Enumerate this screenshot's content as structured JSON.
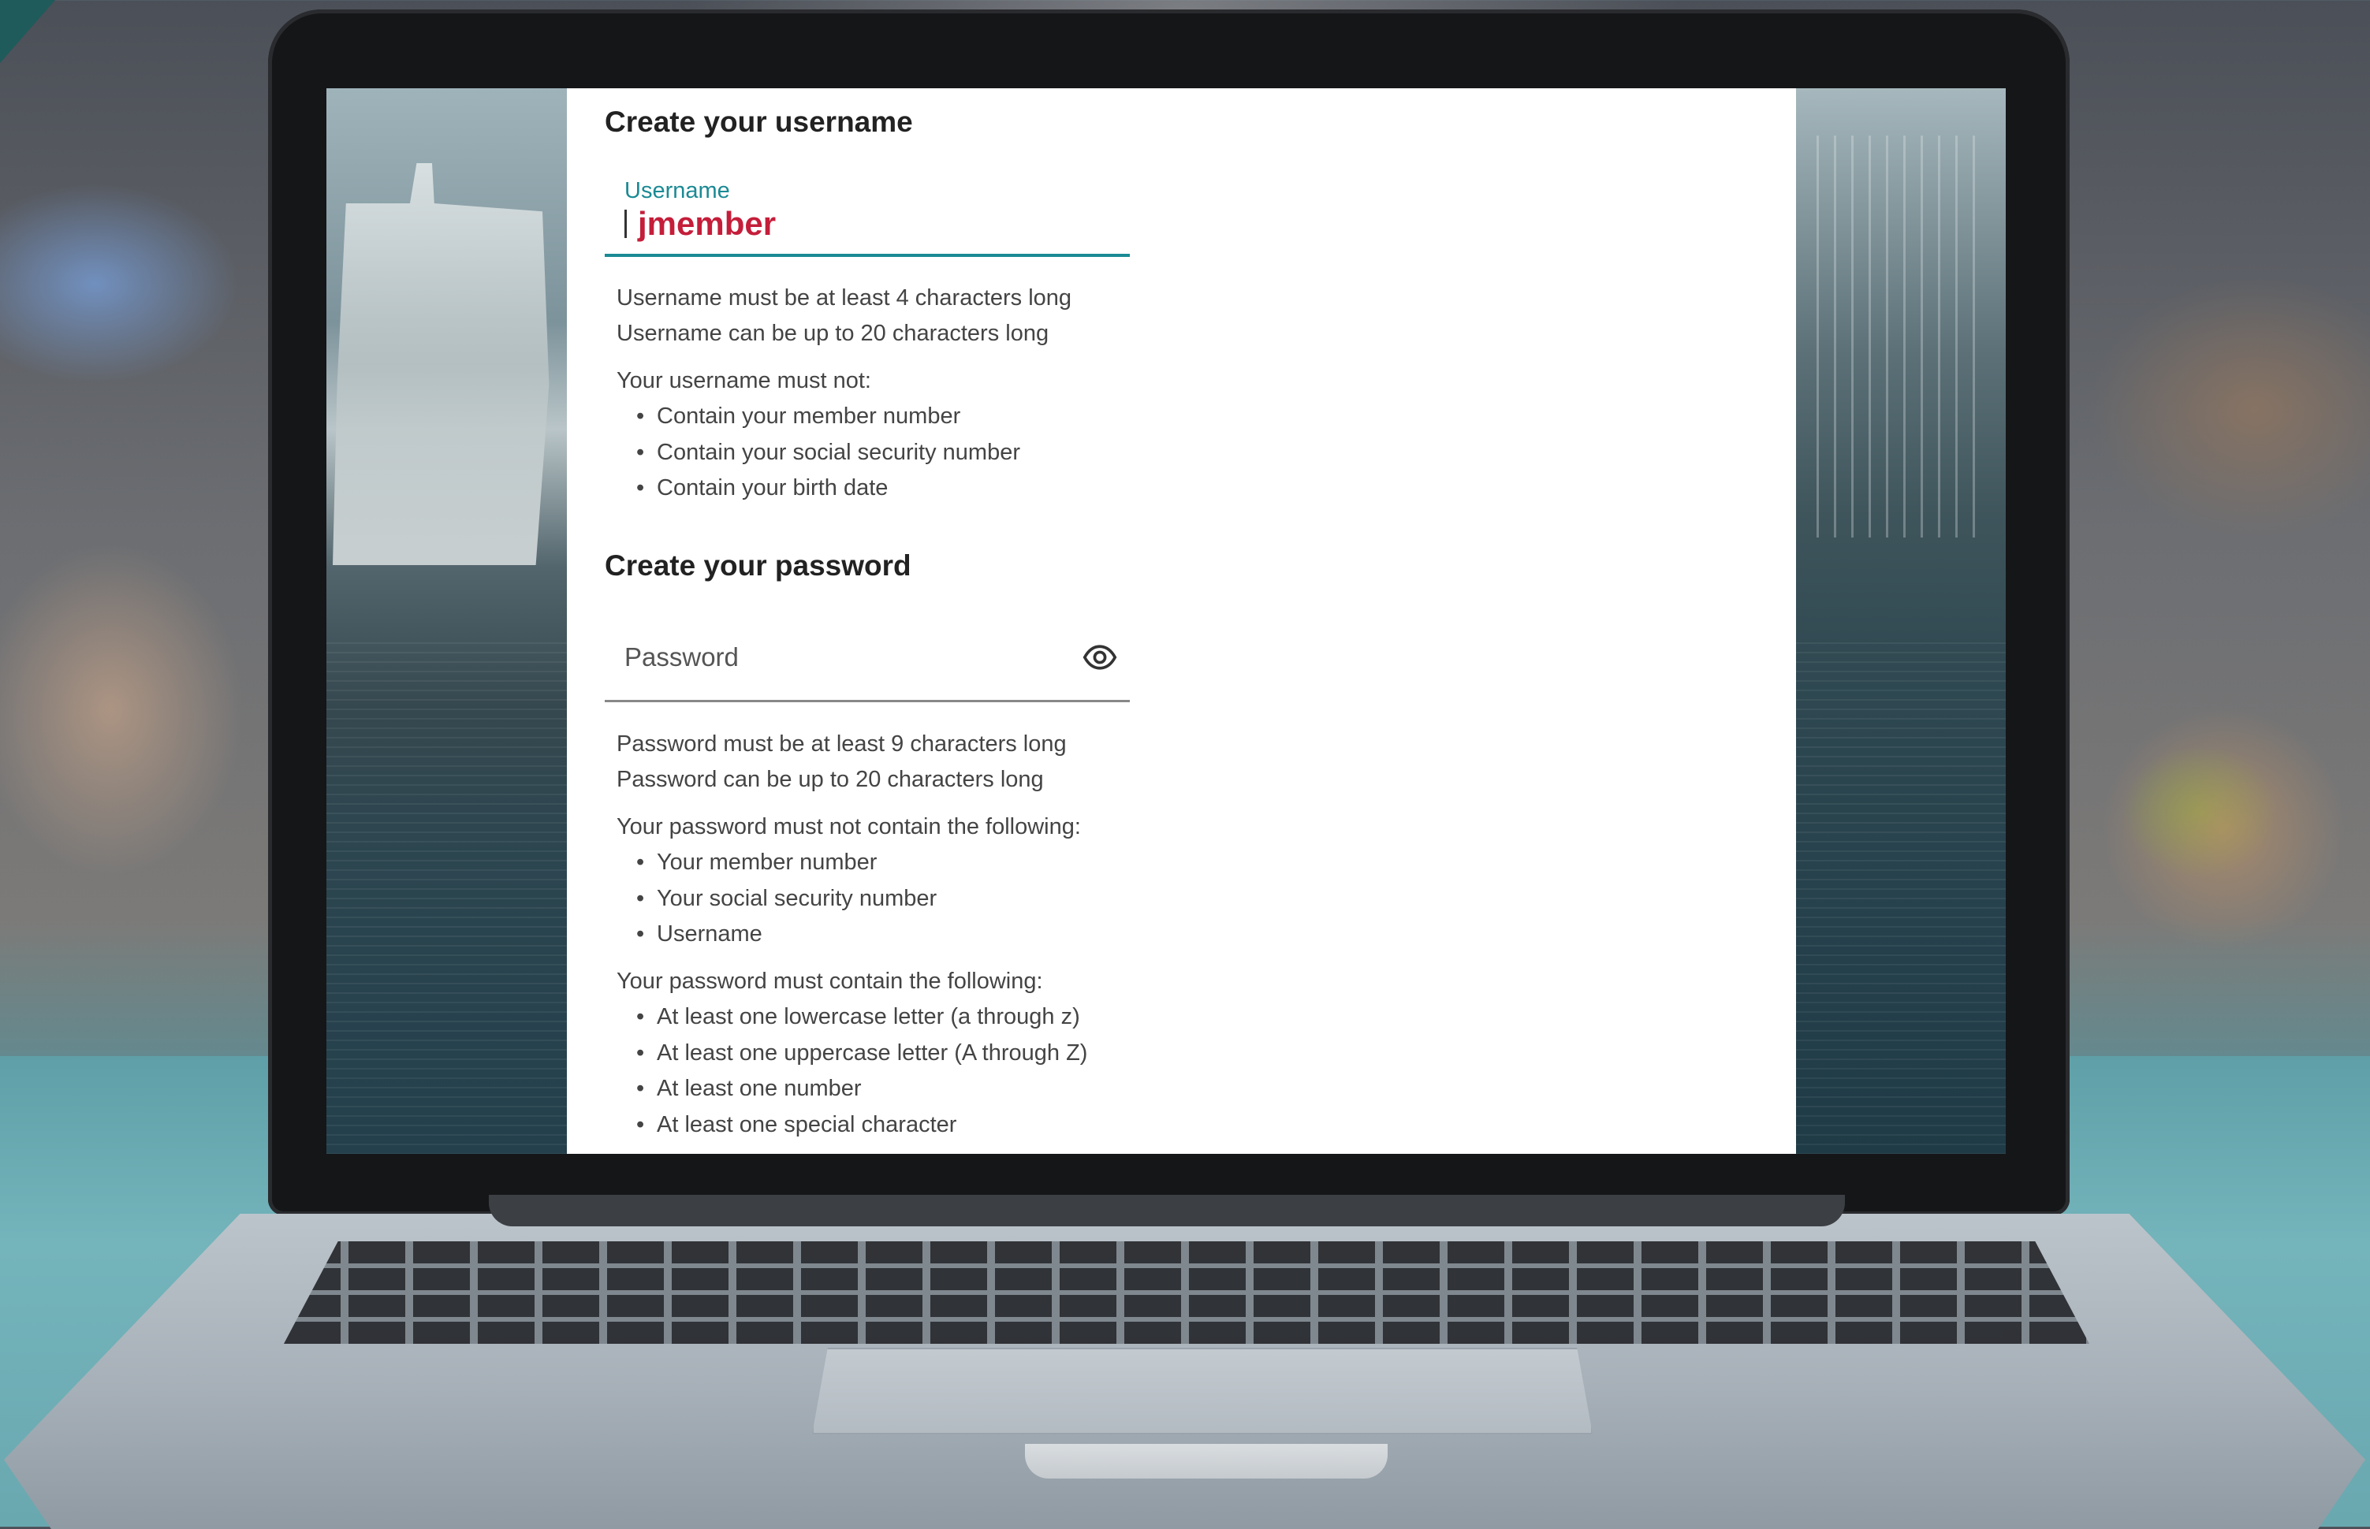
{
  "username_section": {
    "heading": "Create your username",
    "field_label": "Username",
    "field_value": "jmember",
    "rules": [
      "Username must be at least 4 characters long",
      "Username can be up to 20 characters long"
    ],
    "must_not_heading": "Your username must not:",
    "must_not_items": [
      "Contain your member number",
      "Contain your social security number",
      "Contain your birth date"
    ]
  },
  "password_section": {
    "heading": "Create your password",
    "placeholder": "Password",
    "visibility_icon": "eye-icon",
    "rules": [
      "Password must be at least 9 characters long",
      "Password can be up to 20 characters long"
    ],
    "must_not_heading": "Your password must not contain the following:",
    "must_not_items": [
      "Your member number",
      "Your social security number",
      "Username"
    ],
    "must_heading": "Your password must contain the following:",
    "must_items": [
      "At least one lowercase letter (a through z)",
      "At least one uppercase letter (A through Z)",
      "At least one number",
      "At least one special character"
    ]
  },
  "colors": {
    "accent_teal": "#1b8a94",
    "username_value": "#c41e3a",
    "field_underline_active": "#1b8a94",
    "field_underline": "#888888"
  }
}
